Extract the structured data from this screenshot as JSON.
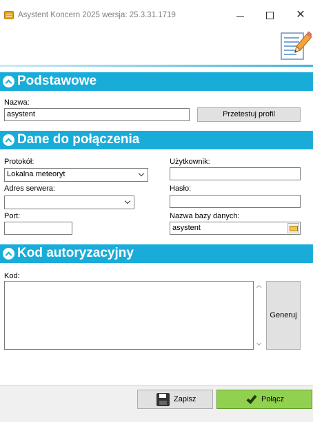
{
  "window": {
    "title": "Asystent Koncern 2025 wersja: 25.3.31.1719",
    "close_glyph": "✕"
  },
  "icons": {
    "app": "app-icon",
    "logo": "document-pencil-icon",
    "section_toggle": "chevron-up-circle-icon",
    "browse": "folder-open-icon",
    "save": "floppy-disk-icon",
    "connect": "checkmark-icon"
  },
  "colors": {
    "section_bar": "#19acd9",
    "connect_button": "#92d050",
    "footer": "#f0f0f0"
  },
  "sections": {
    "basic": {
      "title": "Podstawowe",
      "name_label": "Nazwa:",
      "name_value": "asystent",
      "test_button": "Przetestuj profil"
    },
    "connection": {
      "title": "Dane do połączenia",
      "protocol_label": "Protokół:",
      "protocol_value": "Lokalna meteoryt",
      "server_label": "Adres serwera:",
      "server_value": "",
      "port_label": "Port:",
      "port_value": "",
      "user_label": "Użytkownik:",
      "user_value": "",
      "password_label": "Hasło:",
      "password_value": "",
      "db_label": "Nazwa bazy danych:",
      "db_value": "asystent"
    },
    "auth": {
      "title": "Kod autoryzacyjny",
      "code_label": "Kod:",
      "code_value": "",
      "generate_button": "Generuj"
    }
  },
  "footer": {
    "save_label": "Zapisz",
    "connect_label": "Połącz"
  }
}
